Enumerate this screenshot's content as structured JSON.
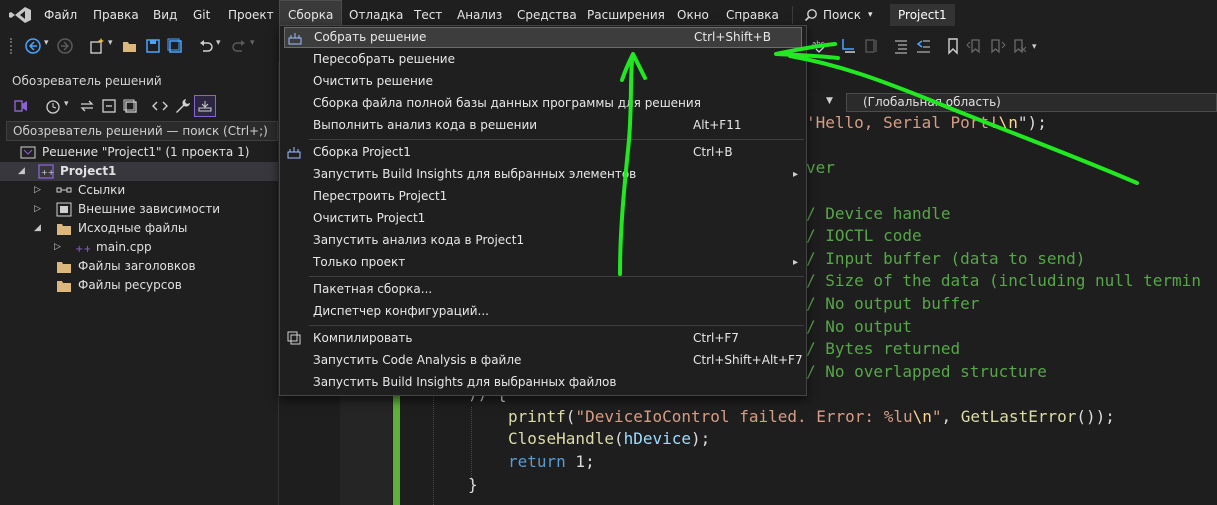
{
  "menubar": {
    "items": [
      "Файл",
      "Правка",
      "Вид",
      "Git",
      "Проект",
      "Сборка",
      "Отладка",
      "Тест",
      "Анализ",
      "Средства",
      "Расширения",
      "Окно",
      "Справка"
    ],
    "search_label": "Поиск",
    "project_badge": "Project1"
  },
  "solution_explorer": {
    "title": "Обозреватель решений",
    "search_placeholder": "Обозреватель решений — поиск (Ctrl+;)",
    "tree": {
      "solution": "Решение \"Project1\"  (1 проекта 1)",
      "project": "Project1",
      "refs": "Ссылки",
      "external": "Внешние зависимости",
      "sources": "Исходные файлы",
      "main_cpp": "main.cpp",
      "headers": "Файлы заголовков",
      "resources": "Файлы ресурсов"
    }
  },
  "editor": {
    "scope": "(Глобальная область)",
    "code": {
      "l1_str": "'Hello, Serial Port!",
      "l1_esc": "\\n",
      "l1_end": "\");",
      "l2": "ver",
      "c1": "/ Device handle",
      "c2": "/ IOCTL code",
      "c3": "/ Input buffer (data to send)",
      "c4": "/ Size of the data (including null termin",
      "c5": "/ No output buffer",
      "c6": "/ No output",
      "c7": "/ Bytes returned",
      "c8": "/ No overlapped structure",
      "close": ")) {",
      "printf_fn": "printf",
      "printf_open": "(",
      "printf_str": "\"DeviceIoControl failed. Error: %lu",
      "printf_esc": "\\n",
      "printf_str_end": "\"",
      "printf_mid": ", ",
      "getlast_fn": "GetLastError",
      "printf_end": "());",
      "close_fn": "CloseHandle",
      "close_open": "(",
      "close_var": "hDevice",
      "close_end": ");",
      "ret_kw": "return",
      "ret_val": " 1;",
      "brace": "}"
    }
  },
  "build_menu": {
    "items": [
      {
        "label": "Собрать решение",
        "shortcut": "Ctrl+Shift+B"
      },
      {
        "label": "Пересобрать решение",
        "shortcut": ""
      },
      {
        "label": "Очистить решение",
        "shortcut": ""
      },
      {
        "label": "Сборка файла полной базы данных программы для решения",
        "shortcut": ""
      },
      {
        "label": "Выполнить анализ кода в решении",
        "shortcut": "Alt+F11"
      },
      {
        "label": "Сборка Project1",
        "shortcut": "Ctrl+B"
      },
      {
        "label": "Запустить Build Insights для выбранных элементов",
        "shortcut": ""
      },
      {
        "label": "Перестроить Project1",
        "shortcut": ""
      },
      {
        "label": "Очистить Project1",
        "shortcut": ""
      },
      {
        "label": "Запустить анализ кода в Project1",
        "shortcut": ""
      },
      {
        "label": "Только проект",
        "shortcut": ""
      },
      {
        "label": "Пакетная сборка...",
        "shortcut": ""
      },
      {
        "label": "Диспетчер конфигураций...",
        "shortcut": ""
      },
      {
        "label": "Компилировать",
        "shortcut": "Ctrl+F7"
      },
      {
        "label": "Запустить Code Analysis в файле",
        "shortcut": "Ctrl+Shift+Alt+F7"
      },
      {
        "label": "Запустить Build Insights для выбранных файлов",
        "shortcut": ""
      }
    ]
  },
  "colors": {
    "annotation_green": "#22e822",
    "vs_purple": "#8a63d2",
    "change_bar": "#5fb139"
  }
}
